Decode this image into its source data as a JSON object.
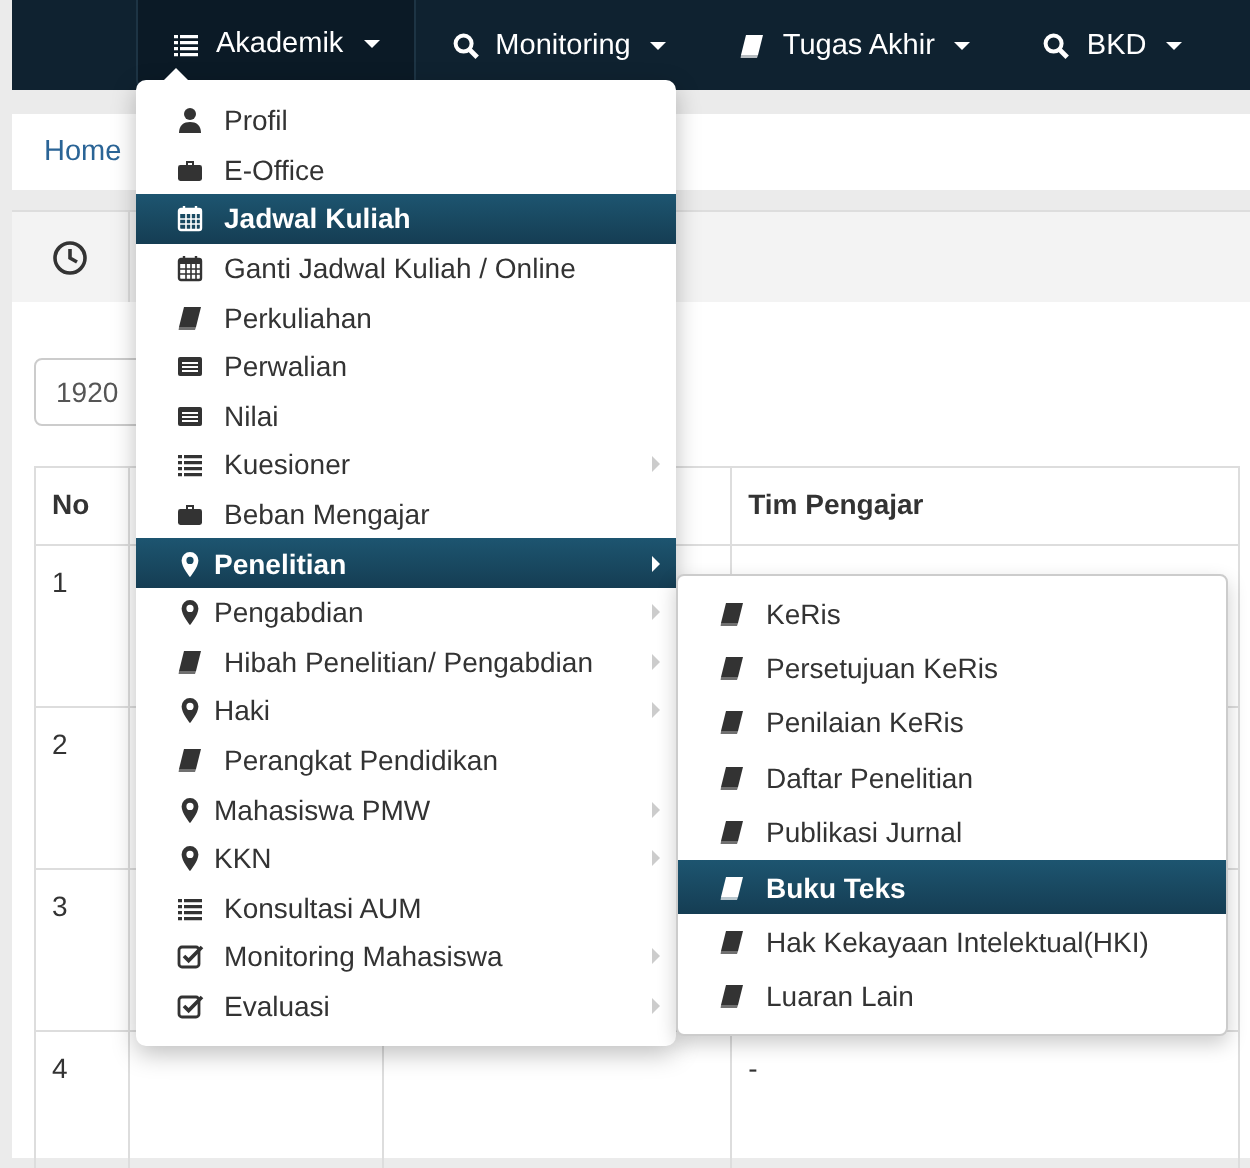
{
  "navbar": {
    "items": [
      {
        "label": "Akademik",
        "kind": "list",
        "open": true
      },
      {
        "label": "Monitoring",
        "kind": "search",
        "open": false
      },
      {
        "label": "Tugas Akhir",
        "kind": "book",
        "open": false
      },
      {
        "label": "BKD",
        "kind": "search",
        "open": false
      }
    ]
  },
  "breadcrumb": {
    "items": [
      "Home"
    ]
  },
  "semester_select": {
    "value": "1920"
  },
  "table": {
    "columns": [
      "No",
      "",
      "",
      "Tim Pengajar"
    ],
    "rows": [
      {
        "cells": [
          "1",
          "",
          "",
          ""
        ]
      },
      {
        "cells": [
          "2",
          "",
          "",
          ""
        ]
      },
      {
        "cells": [
          "3",
          "",
          "",
          ""
        ]
      },
      {
        "cells": [
          "4",
          "",
          "",
          "-"
        ]
      }
    ]
  },
  "menu": {
    "items": [
      {
        "label": "Profil",
        "kind": "user",
        "selected": false,
        "has_submenu": false
      },
      {
        "label": "E-Office",
        "kind": "briefcase",
        "selected": false,
        "has_submenu": false
      },
      {
        "label": "Jadwal Kuliah",
        "kind": "calendar",
        "selected": true,
        "has_submenu": false
      },
      {
        "label": "Ganti Jadwal Kuliah / Online",
        "kind": "calendar",
        "selected": false,
        "has_submenu": false
      },
      {
        "label": "Perkuliahan",
        "kind": "book",
        "selected": false,
        "has_submenu": false
      },
      {
        "label": "Perwalian",
        "kind": "card",
        "selected": false,
        "has_submenu": false
      },
      {
        "label": "Nilai",
        "kind": "card",
        "selected": false,
        "has_submenu": false
      },
      {
        "label": "Kuesioner",
        "kind": "list",
        "selected": false,
        "has_submenu": true
      },
      {
        "label": "Beban Mengajar",
        "kind": "briefcase",
        "selected": false,
        "has_submenu": false
      },
      {
        "label": "Penelitian",
        "kind": "marker",
        "selected": true,
        "has_submenu": true,
        "submenu": [
          {
            "label": "KeRis",
            "kind": "book",
            "selected": false
          },
          {
            "label": "Persetujuan KeRis",
            "kind": "book",
            "selected": false
          },
          {
            "label": "Penilaian KeRis",
            "kind": "book",
            "selected": false
          },
          {
            "label": "Daftar Penelitian",
            "kind": "book",
            "selected": false
          },
          {
            "label": "Publikasi Jurnal",
            "kind": "book",
            "selected": false
          },
          {
            "label": "Buku Teks",
            "kind": "book",
            "selected": true
          },
          {
            "label": "Hak Kekayaan Intelektual(HKI)",
            "kind": "book",
            "selected": false
          },
          {
            "label": "Luaran Lain",
            "kind": "book",
            "selected": false
          }
        ]
      },
      {
        "label": "Pengabdian",
        "kind": "marker",
        "selected": false,
        "has_submenu": true
      },
      {
        "label": "Hibah Penelitian/ Pengabdian",
        "kind": "book",
        "selected": false,
        "has_submenu": true
      },
      {
        "label": "Haki",
        "kind": "marker",
        "selected": false,
        "has_submenu": true
      },
      {
        "label": "Perangkat Pendidikan",
        "kind": "book",
        "selected": false,
        "has_submenu": false
      },
      {
        "label": "Mahasiswa PMW",
        "kind": "marker",
        "selected": false,
        "has_submenu": true
      },
      {
        "label": "KKN",
        "kind": "marker",
        "selected": false,
        "has_submenu": true
      },
      {
        "label": "Konsultasi AUM",
        "kind": "list",
        "selected": false,
        "has_submenu": false
      },
      {
        "label": "Monitoring Mahasiswa",
        "kind": "check",
        "selected": false,
        "has_submenu": true
      },
      {
        "label": "Evaluasi",
        "kind": "check",
        "selected": false,
        "has_submenu": true
      }
    ]
  }
}
